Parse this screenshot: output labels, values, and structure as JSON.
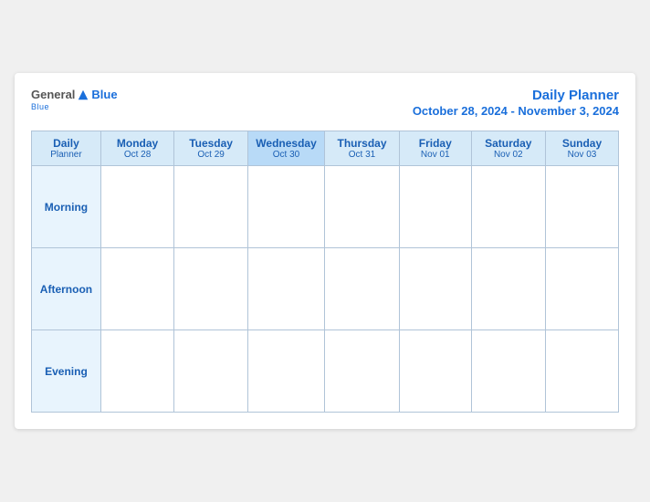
{
  "header": {
    "logo": {
      "general": "General",
      "blue": "Blue",
      "tagline": "Blue"
    },
    "title": "Daily Planner",
    "date_range": "October 28, 2024 - November 3, 2024"
  },
  "columns": [
    {
      "id": "label",
      "day": "Daily",
      "sub": "Planner",
      "highlighted": false
    },
    {
      "id": "mon",
      "day": "Monday",
      "sub": "Oct 28",
      "highlighted": false
    },
    {
      "id": "tue",
      "day": "Tuesday",
      "sub": "Oct 29",
      "highlighted": false
    },
    {
      "id": "wed",
      "day": "Wednesday",
      "sub": "Oct 30",
      "highlighted": true
    },
    {
      "id": "thu",
      "day": "Thursday",
      "sub": "Oct 31",
      "highlighted": false
    },
    {
      "id": "fri",
      "day": "Friday",
      "sub": "Nov 01",
      "highlighted": false
    },
    {
      "id": "sat",
      "day": "Saturday",
      "sub": "Nov 02",
      "highlighted": false
    },
    {
      "id": "sun",
      "day": "Sunday",
      "sub": "Nov 03",
      "highlighted": false
    }
  ],
  "rows": [
    {
      "label": "Morning"
    },
    {
      "label": "Afternoon"
    },
    {
      "label": "Evening"
    }
  ]
}
